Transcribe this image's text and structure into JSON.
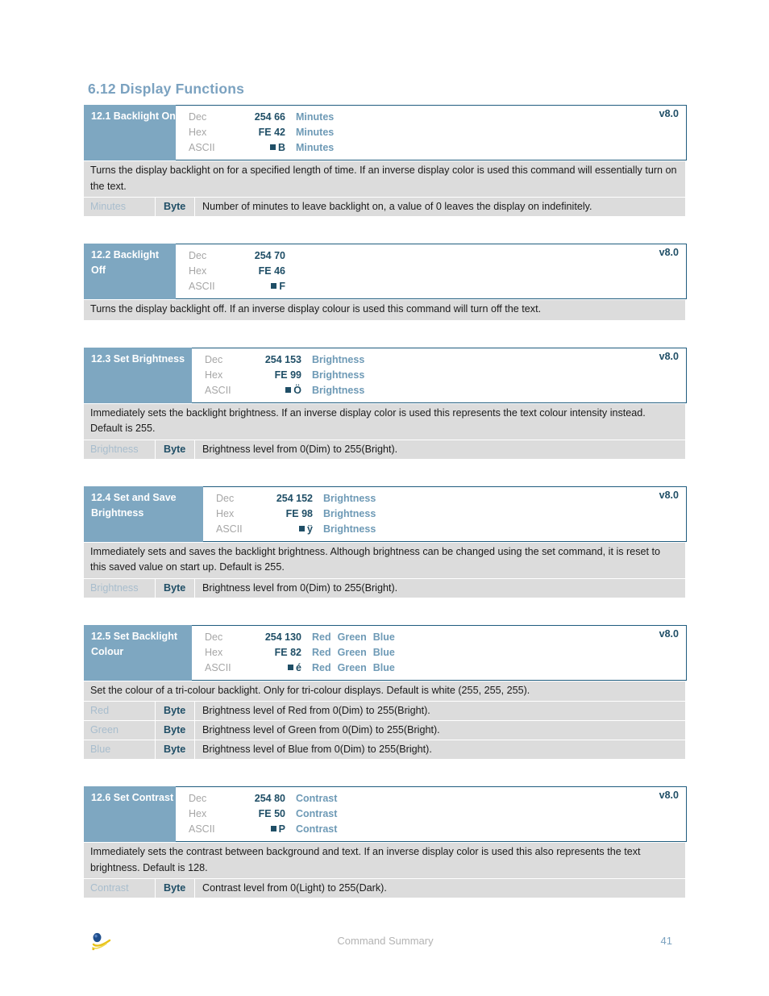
{
  "document": {
    "section_heading": "6.12 Display Functions",
    "footer": {
      "center_text": "Command Summary",
      "page_number": "41",
      "logo_name": "matrix-orbital-logo"
    }
  },
  "colors": {
    "heading_blue": "#7ba2c0",
    "label_cell_blue": "#7ea7c1",
    "value_navy": "#1f4e66",
    "arg_blue": "#6e9ab6",
    "border_navy": "#1f5c7e",
    "row_gray": "#dcdcdc",
    "kind_gray": "#a6a6a6",
    "param_name_blue": "#a8bdcd",
    "footer_gray": "#b3b3b3"
  },
  "syntax_labels": {
    "dec": "Dec",
    "hex": "Hex",
    "ascii": "ASCII"
  },
  "commands": [
    {
      "id": "12.1",
      "title": "12.1 Backlight On",
      "version": "v8.0",
      "dec": "254 66",
      "hex": "FE 42",
      "ascii": "B",
      "ascii_has_nonprintable": true,
      "args": [
        "Minutes"
      ],
      "description": "Turns the display backlight on for a specified length of time.  If an inverse display color is used this command will essentially turn on the text.",
      "parameters": [
        {
          "name": "Minutes",
          "type": "Byte",
          "description": "Number of minutes to leave backlight on, a value of 0 leaves the display on indefinitely."
        }
      ]
    },
    {
      "id": "12.2",
      "title": "12.2 Backlight Off",
      "version": "v8.0",
      "dec": "254 70",
      "hex": "FE 46",
      "ascii": "F",
      "ascii_has_nonprintable": true,
      "args": [],
      "description": "Turns the display backlight off.  If an inverse display colour is used this command will turn off the text.",
      "parameters": []
    },
    {
      "id": "12.3",
      "title": "12.3 Set Brightness",
      "version": "v8.0",
      "dec": "254 153",
      "hex": "FE 99",
      "ascii": "Ö",
      "ascii_has_nonprintable": true,
      "args": [
        "Brightness"
      ],
      "description": "Immediately sets the backlight brightness.  If an inverse display color is used this represents the text colour intensity instead.  Default is 255.",
      "parameters": [
        {
          "name": "Brightness",
          "type": "Byte",
          "description": "Brightness level from 0(Dim) to 255(Bright)."
        }
      ]
    },
    {
      "id": "12.4",
      "title": "12.4 Set and Save Brightness",
      "version": "v8.0",
      "dec": "254 152",
      "hex": "FE 98",
      "ascii": "ÿ",
      "ascii_has_nonprintable": true,
      "args": [
        "Brightness"
      ],
      "description": "Immediately sets and saves the backlight brightness.  Although brightness can be changed using the set command, it is reset to this saved value on start up.  Default is 255.",
      "parameters": [
        {
          "name": "Brightness",
          "type": "Byte",
          "description": "Brightness level from 0(Dim) to 255(Bright)."
        }
      ]
    },
    {
      "id": "12.5",
      "title": "12.5 Set Backlight Colour",
      "version": "v8.0",
      "dec": "254 130",
      "hex": "FE 82",
      "ascii": "é",
      "ascii_has_nonprintable": true,
      "args": [
        "Red",
        "Green",
        "Blue"
      ],
      "description": "Set the colour of a tri-colour backlight.  Only for tri-colour displays.  Default is white (255, 255, 255).",
      "parameters": [
        {
          "name": "Red",
          "type": "Byte",
          "description": "Brightness level of Red from 0(Dim) to 255(Bright)."
        },
        {
          "name": "Green",
          "type": "Byte",
          "description": "Brightness level of Green from 0(Dim) to 255(Bright)."
        },
        {
          "name": "Blue",
          "type": "Byte",
          "description": "Brightness level of Blue from 0(Dim) to 255(Bright)."
        }
      ]
    },
    {
      "id": "12.6",
      "title": "12.6 Set Contrast",
      "version": "v8.0",
      "dec": "254 80",
      "hex": "FE 50",
      "ascii": "P",
      "ascii_has_nonprintable": true,
      "args": [
        "Contrast"
      ],
      "description": "Immediately sets the contrast between background and text.  If an inverse display color is used this also represents the text brightness.  Default is 128.",
      "parameters": [
        {
          "name": "Contrast",
          "type": "Byte",
          "description": "Contrast level from 0(Light) to 255(Dark)."
        }
      ]
    }
  ]
}
